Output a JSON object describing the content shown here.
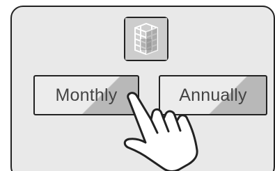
{
  "billing_toggle": {
    "monthly_label": "Monthly",
    "annually_label": "Annually"
  },
  "icons": {
    "logo": "cube-logo-icon",
    "pointer": "hand-pointer-icon"
  },
  "colors": {
    "panel_background": "#e9e9e9",
    "outline": "#222222",
    "button_shade": "#b8b8b8",
    "label_text": "#444444"
  }
}
